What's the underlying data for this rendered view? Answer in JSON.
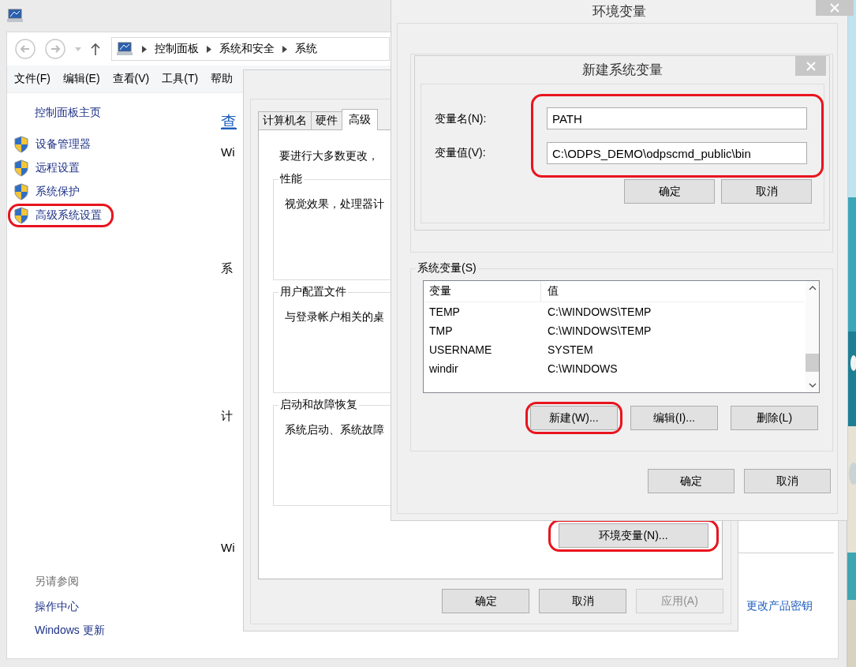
{
  "explorer": {
    "address_path": [
      "控制面板",
      "系统和安全",
      "系统"
    ],
    "menu": [
      "文件(F)",
      "编辑(E)",
      "查看(V)",
      "工具(T)",
      "帮助"
    ],
    "sidebar": {
      "home": "控制面板主页",
      "items": [
        {
          "label": "设备管理器",
          "circled": false
        },
        {
          "label": "远程设置",
          "circled": false
        },
        {
          "label": "系统保护",
          "circled": false
        },
        {
          "label": "高级系统设置",
          "circled": true
        }
      ],
      "see_also_heading": "另请参阅",
      "see_also": [
        "操作中心",
        "Windows 更新"
      ]
    },
    "content_fragments": [
      {
        "kind": "link",
        "text": "查"
      },
      {
        "kind": "text",
        "text": "Wi"
      },
      {
        "kind": "text",
        "text": "系"
      },
      {
        "kind": "text",
        "text": "计"
      },
      {
        "kind": "text",
        "text": "Wi"
      }
    ],
    "product_key_link": "更改产品密钥"
  },
  "system_properties": {
    "tabs": [
      {
        "label": "计算机名",
        "selected": false
      },
      {
        "label": "硬件",
        "selected": false
      },
      {
        "label": "高级",
        "selected": true
      }
    ],
    "intro": "要进行大多数更改，",
    "groups": [
      {
        "title": "性能",
        "text": "视觉效果，处理器计"
      },
      {
        "title": "用户配置文件",
        "text": "与登录帐户相关的桌"
      },
      {
        "title": "启动和故障恢复",
        "text": "系统启动、系统故障"
      }
    ],
    "env_button": {
      "label": "环境变量(N)...",
      "circled": true
    },
    "buttons": [
      {
        "label": "确定",
        "disabled": false
      },
      {
        "label": "取消",
        "disabled": false
      },
      {
        "label": "应用(A)",
        "disabled": true
      }
    ]
  },
  "environment_variables": {
    "title": "环境变量",
    "system_variables": {
      "title": "系统变量(S)",
      "columns": [
        "变量",
        "值"
      ],
      "rows": [
        [
          "TEMP",
          "C:\\WINDOWS\\TEMP"
        ],
        [
          "TMP",
          "C:\\WINDOWS\\TEMP"
        ],
        [
          "USERNAME",
          "SYSTEM"
        ],
        [
          "windir",
          "C:\\WINDOWS"
        ]
      ],
      "buttons": [
        {
          "label": "新建(W)...",
          "circled": true
        },
        {
          "label": "编辑(I)...",
          "circled": false
        },
        {
          "label": "删除(L)",
          "circled": false
        }
      ]
    },
    "buttons": [
      "确定",
      "取消"
    ]
  },
  "new_system_variable": {
    "title": "新建系统变量",
    "fields": [
      {
        "label": "变量名(N):",
        "value": "PATH"
      },
      {
        "label": "变量值(V):",
        "value": "C:\\ODPS_DEMO\\odpscmd_public\\bin"
      }
    ],
    "fields_circled": true,
    "buttons": [
      "确定",
      "取消"
    ]
  }
}
